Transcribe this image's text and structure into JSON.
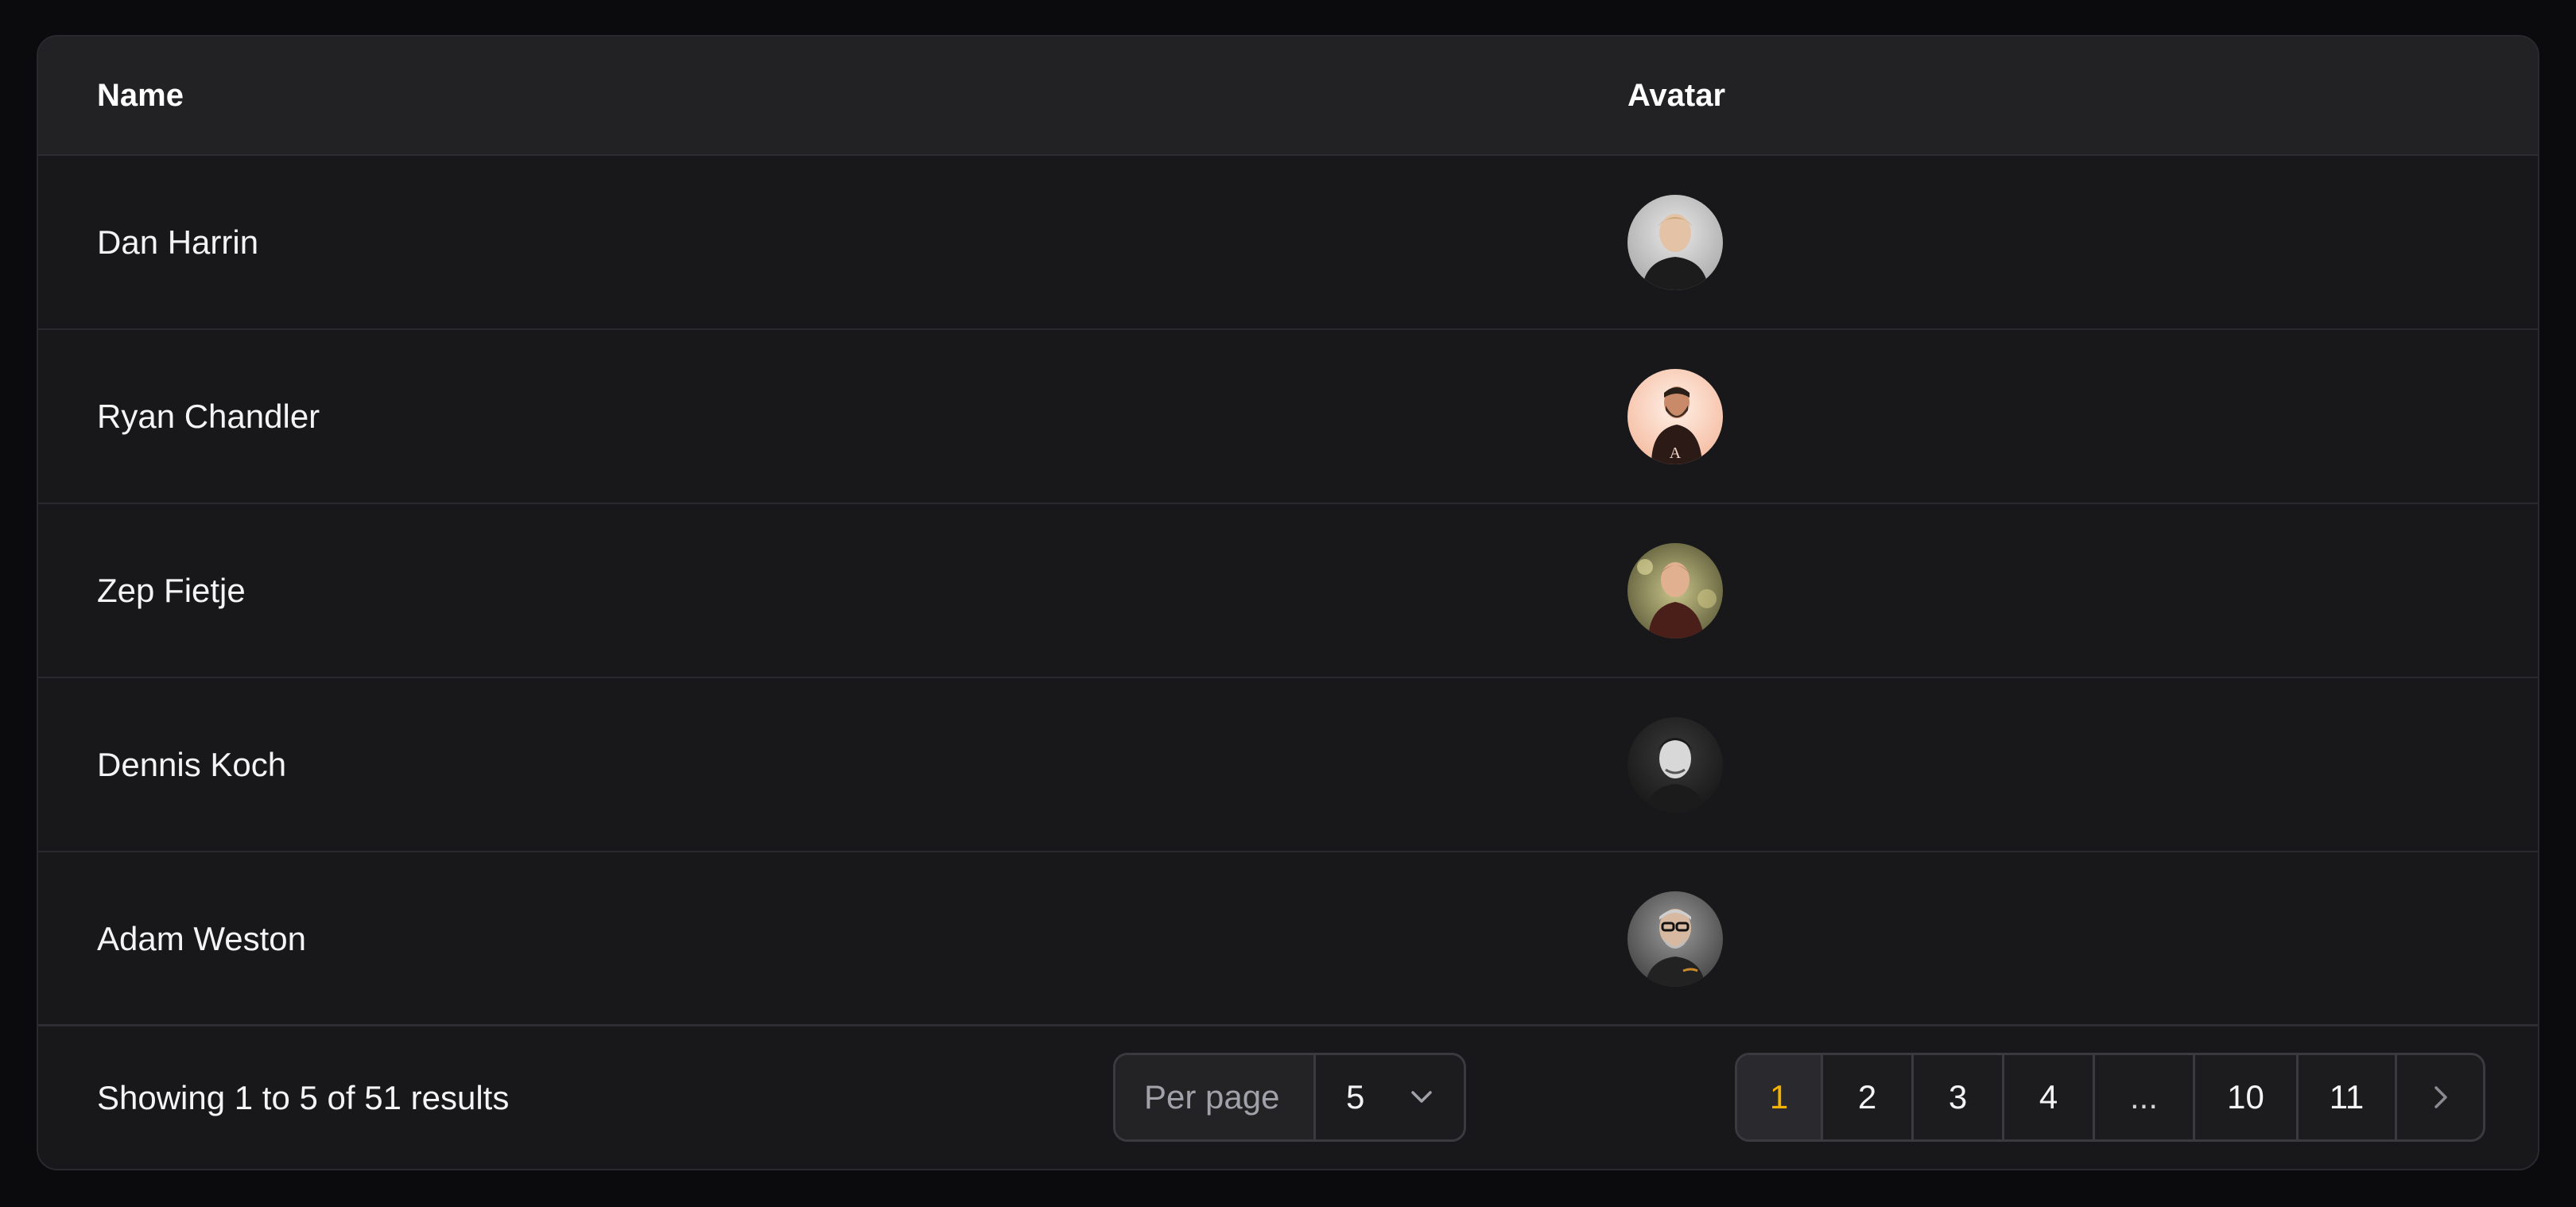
{
  "table": {
    "columns": {
      "name": "Name",
      "avatar": "Avatar"
    },
    "rows": [
      {
        "name": "Dan Harrin",
        "avatar_icon": "user-photo-icon"
      },
      {
        "name": "Ryan Chandler",
        "avatar_icon": "user-photo-icon"
      },
      {
        "name": "Zep Fietje",
        "avatar_icon": "user-photo-icon"
      },
      {
        "name": "Dennis Koch",
        "avatar_icon": "user-photo-icon"
      },
      {
        "name": "Adam Weston",
        "avatar_icon": "user-photo-icon"
      }
    ]
  },
  "footer": {
    "summary": "Showing 1 to 5 of 51 results",
    "per_page_label": "Per page",
    "per_page_value": "5",
    "pages": [
      "1",
      "2",
      "3",
      "4",
      "...",
      "10",
      "11"
    ],
    "current_page": "1",
    "next_icon": "chevron-right-icon",
    "select_icon": "chevron-down-icon"
  },
  "colors": {
    "background": "#0b0b0d",
    "card": "#18181b",
    "header": "#222225",
    "accent": "#f5b301",
    "border": "#3a3a3f"
  }
}
